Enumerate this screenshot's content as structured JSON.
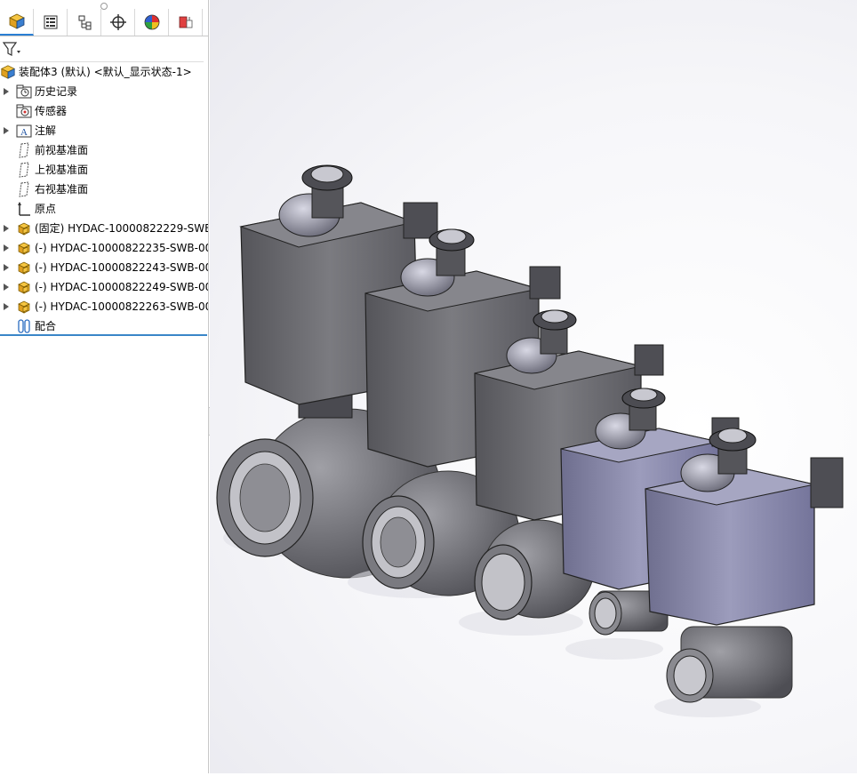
{
  "tree": {
    "root_label": "装配体3 (默认) <默认_显示状态-1>",
    "items": [
      {
        "label": "历史记录",
        "icon": "history-folder-icon",
        "expandable": true
      },
      {
        "label": "传感器",
        "icon": "sensor-folder-icon",
        "expandable": false
      },
      {
        "label": "注解",
        "icon": "annotation-icon",
        "expandable": true
      },
      {
        "label": "前视基准面",
        "icon": "plane-icon",
        "expandable": false
      },
      {
        "label": "上视基准面",
        "icon": "plane-icon",
        "expandable": false
      },
      {
        "label": "右视基准面",
        "icon": "plane-icon",
        "expandable": false
      },
      {
        "label": "原点",
        "icon": "origin-icon",
        "expandable": false
      },
      {
        "label": "(固定) HYDAC-10000822229-SWB",
        "icon": "part-icon",
        "expandable": true
      },
      {
        "label": "(-) HYDAC-10000822235-SWB-00",
        "icon": "part-icon",
        "expandable": true
      },
      {
        "label": "(-) HYDAC-10000822243-SWB-00",
        "icon": "part-icon",
        "expandable": true
      },
      {
        "label": "(-) HYDAC-10000822249-SWB-00",
        "icon": "part-icon",
        "expandable": true
      },
      {
        "label": "(-) HYDAC-10000822263-SWB-00",
        "icon": "part-icon",
        "expandable": true
      },
      {
        "label": "配合",
        "icon": "mates-icon",
        "expandable": false
      }
    ]
  },
  "tabs": [
    {
      "name": "featuremanager",
      "icon": "assembly-tree-icon"
    },
    {
      "name": "propertymanager",
      "icon": "property-list-icon"
    },
    {
      "name": "configurationmanager",
      "icon": "configuration-icon"
    },
    {
      "name": "dimxpert",
      "icon": "target-crosshair-icon"
    },
    {
      "name": "displaymanager",
      "icon": "color-pie-icon"
    },
    {
      "name": "cam",
      "icon": "cam-tool-icon"
    }
  ],
  "colors": {
    "selection_line": "#3a86c8",
    "dark_actuator": "#6c6c72",
    "light_actuator": "#8a8aa8",
    "valve_body": "#707074"
  }
}
